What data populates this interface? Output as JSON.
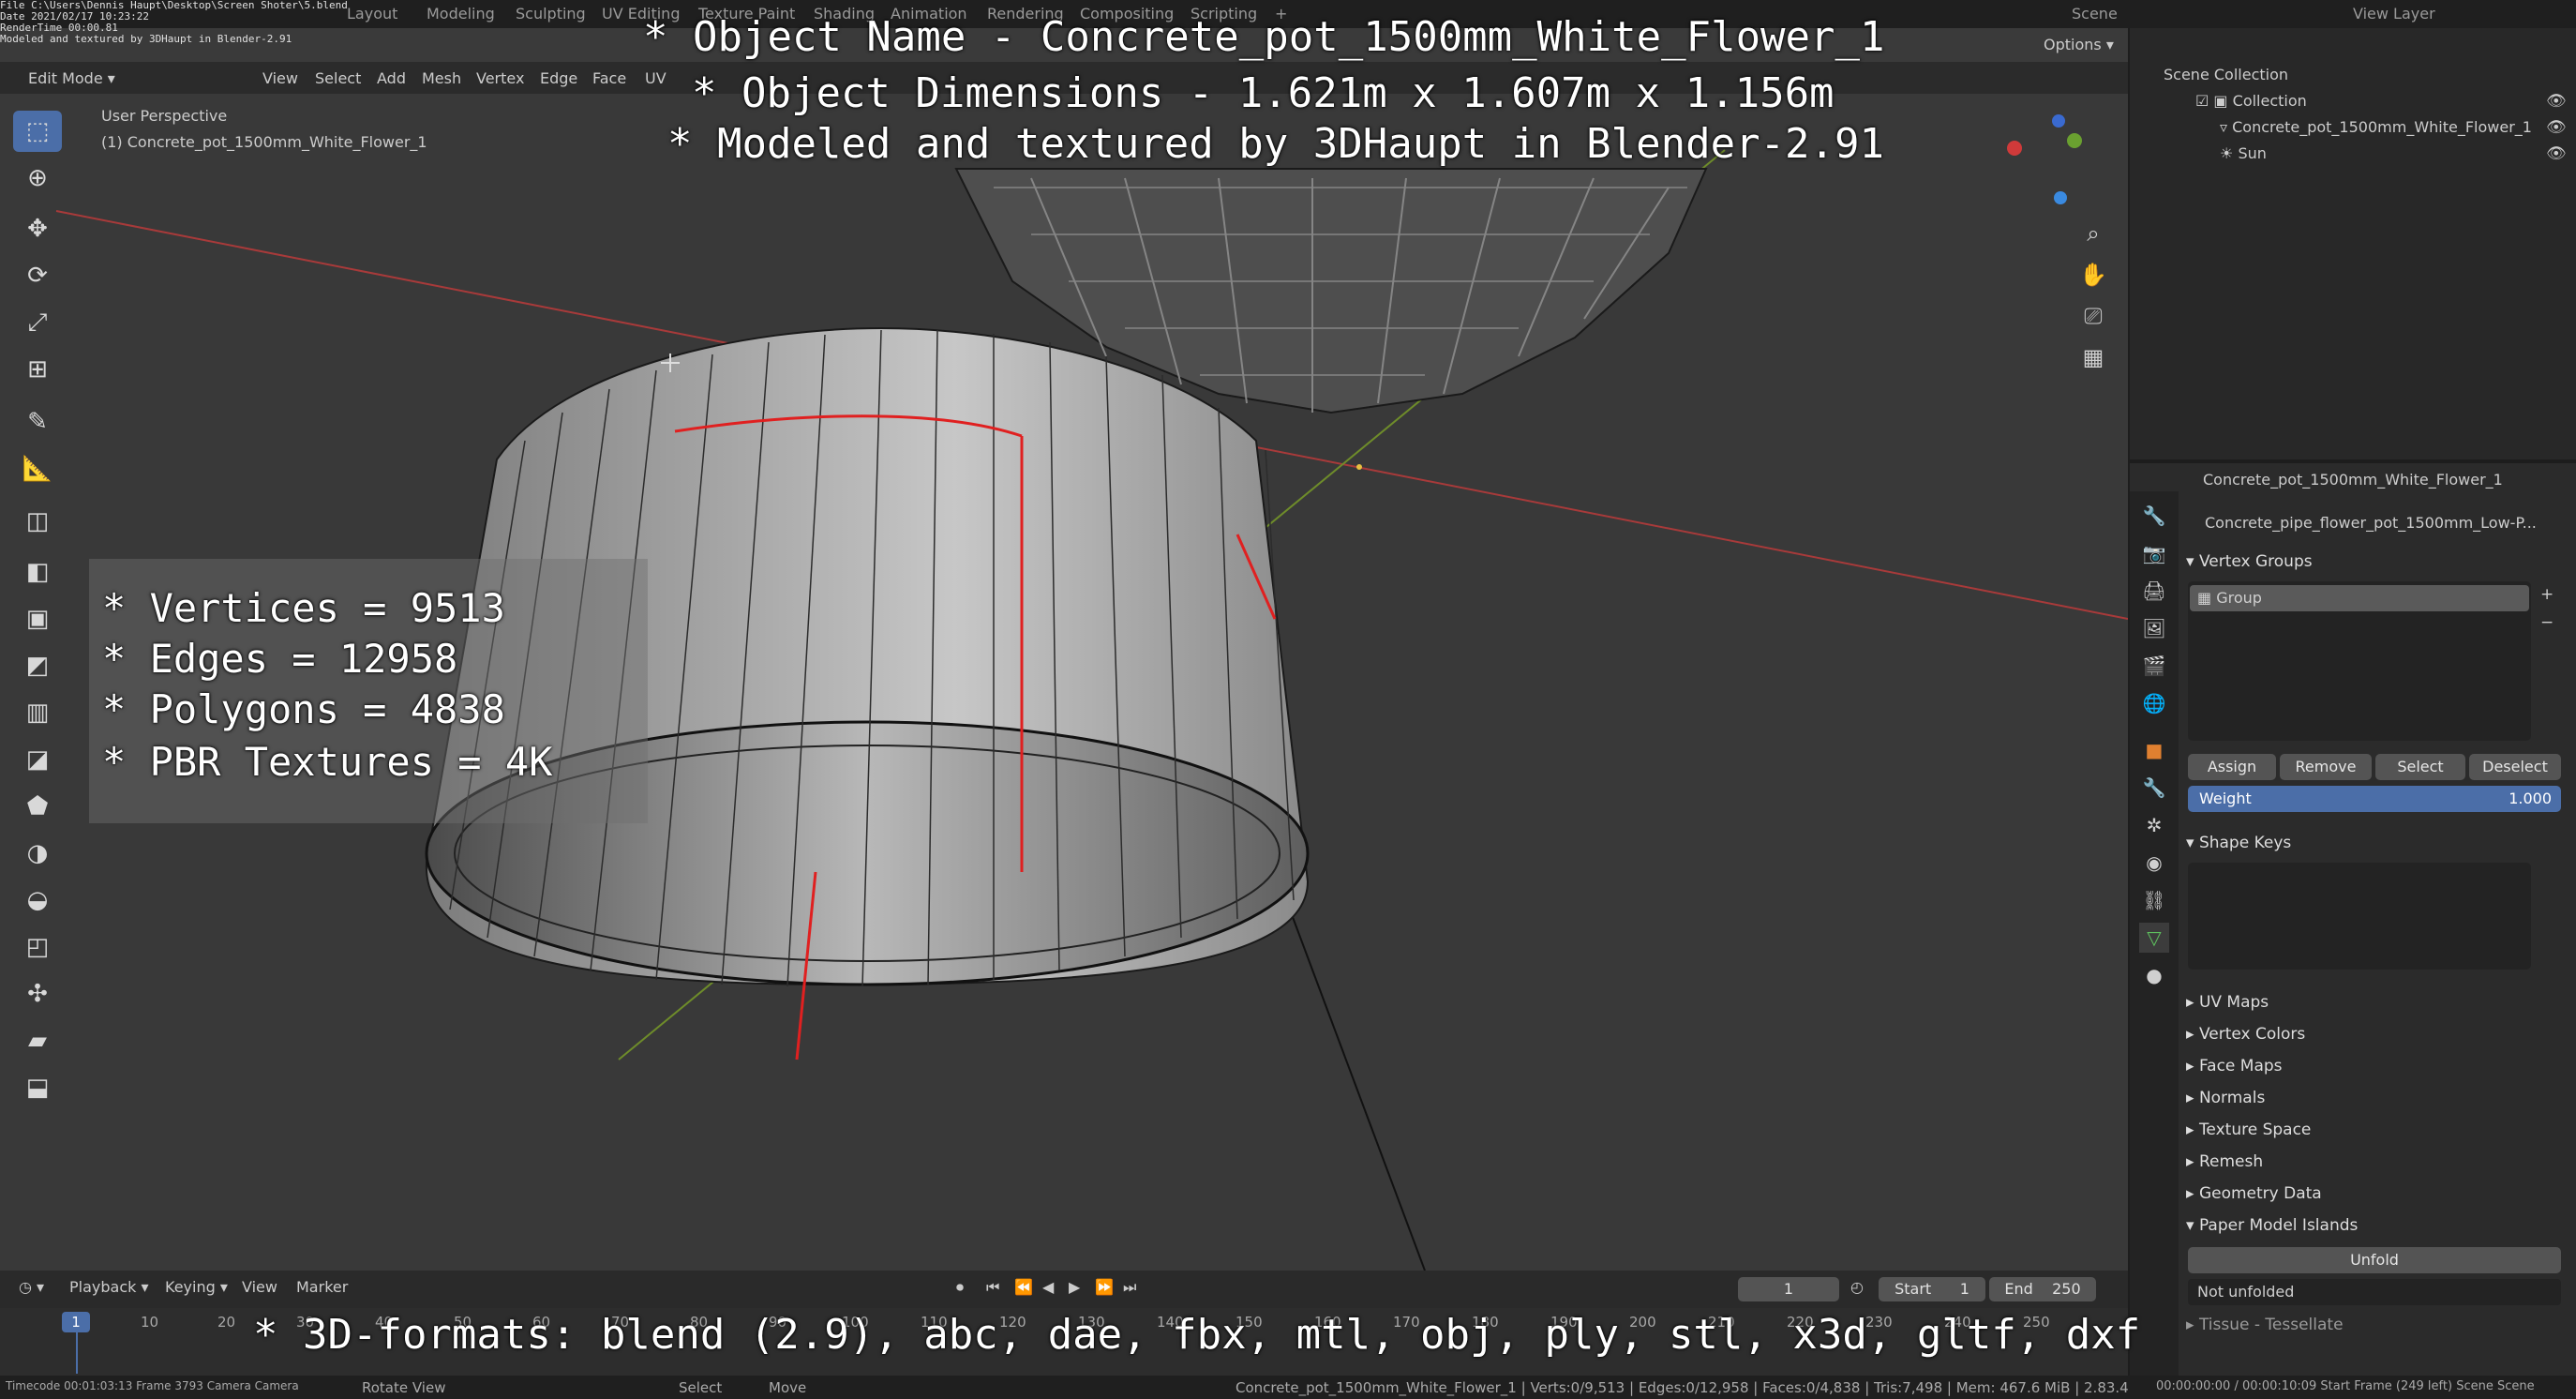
{
  "top_bar": {
    "file_path": "File C:\\Users\\Dennis Haupt\\Desktop\\Screen Shoter\\5.blend",
    "date": "Date 2021/02/17 10:23:22",
    "render_time": "RenderTime 00:00.81",
    "credit_small": "Modeled and textured by 3DHaupt in Blender-2.91",
    "workspace_tabs": [
      "Layout",
      "Modeling",
      "Sculpting",
      "UV Editing",
      "Texture Paint",
      "Shading",
      "Animation",
      "Rendering",
      "Compositing",
      "Scripting"
    ],
    "active_tab": "Layout",
    "scene_label": "Scene",
    "view_layer_label": "View Layer"
  },
  "header": {
    "mode": "Edit Mode",
    "menus": [
      "View",
      "Select",
      "Add",
      "Mesh",
      "Vertex",
      "Edge",
      "Face",
      "UV"
    ],
    "options_label": "Options",
    "axes": [
      "X",
      "Y",
      "Z"
    ]
  },
  "viewport": {
    "perspective_label": "User Perspective",
    "object_label": "(1) Concrete_pot_1500mm_White_Flower_1"
  },
  "overlay": {
    "line1": "* Object Name - Concrete_pot_1500mm_White_Flower_1",
    "line2": "* Object Dimensions - 1.621m x 1.607m x 1.156m",
    "line3": "* Modeled and textured by 3DHaupt in Blender-2.91",
    "stats": [
      "* Vertices = 9513",
      "* Edges = 12958",
      "* Polygons = 4838",
      "* PBR Textures = 4K"
    ],
    "formats": "* 3D-formats: blend (2.9), abc, dae, fbx, mtl, obj, ply, stl, x3d, gltf, dxf"
  },
  "outliner": {
    "root": "Scene Collection",
    "collection": "Collection",
    "items": [
      "Concrete_pot_1500mm_White_Flower_1",
      "Sun"
    ]
  },
  "properties": {
    "object_name": "Concrete_pot_1500mm_White_Flower_1",
    "mesh_name": "Concrete_pipe_flower_pot_1500mm_Low-P...",
    "vertex_groups_title": "Vertex Groups",
    "group_item": "Group",
    "buttons": [
      "Assign",
      "Remove",
      "Select",
      "Deselect"
    ],
    "weight_label": "Weight",
    "weight_value": "1.000",
    "shape_keys_title": "Shape Keys",
    "collapsed_panels": [
      "UV Maps",
      "Vertex Colors",
      "Face Maps",
      "Normals",
      "Texture Space",
      "Remesh",
      "Geometry Data"
    ],
    "paper_model_title": "Paper Model Islands",
    "unfold_label": "Unfold",
    "not_unfolded": "Not unfolded",
    "tissue_label": "Tissue - Tessellate"
  },
  "timeline": {
    "menus": [
      "Playback",
      "Keying",
      "View",
      "Marker"
    ],
    "current_frame": "1",
    "start_label": "Start",
    "start_value": "1",
    "end_label": "End",
    "end_value": "250",
    "ticks": [
      "10",
      "20",
      "30",
      "40",
      "50",
      "60",
      "70",
      "80",
      "90",
      "100",
      "110",
      "120",
      "130",
      "140",
      "150",
      "160",
      "170",
      "180",
      "190",
      "200",
      "210",
      "220",
      "230",
      "240",
      "250"
    ],
    "playhead": "1"
  },
  "status_bar": {
    "left": "Timecode 00:01:03:13  Frame 3793  Camera Camera",
    "rotate_view": "Rotate View",
    "select": "Select",
    "move": "Move",
    "stats": "Concrete_pot_1500mm_White_Flower_1 | Verts:0/9,513 | Edges:0/12,958 | Faces:0/4,838 | Tris:7,498 | Mem: 467.6 MiB | 2.83.4",
    "right": "00:00:00:00 / 00:00:10:09   Start Frame (249 left)  Scene  Scene"
  },
  "colors": {
    "accent": "#4b6ea8",
    "edge_red": "#e02020",
    "x_axis": "#a83a3a",
    "y_axis": "#6e8c2a"
  }
}
